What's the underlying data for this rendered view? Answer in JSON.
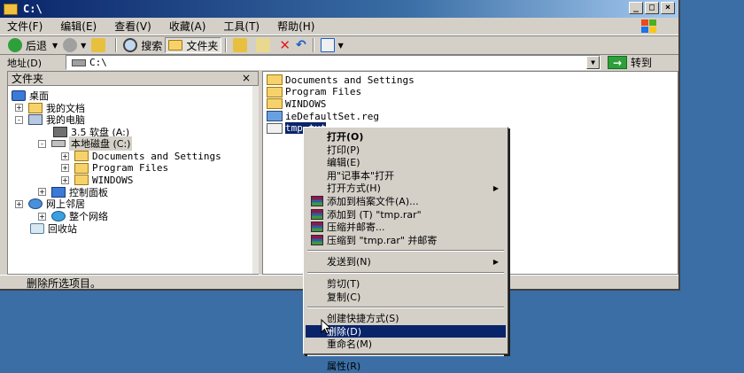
{
  "window": {
    "title": "C:\\",
    "menus": [
      "文件(F)",
      "编辑(E)",
      "查看(V)",
      "收藏(A)",
      "工具(T)",
      "帮助(H)"
    ],
    "toolbar": {
      "back": "后退",
      "search": "搜索",
      "folders": "文件夹"
    },
    "address": {
      "label": "地址(D)",
      "value": "C:\\",
      "go": "转到"
    }
  },
  "left_pane": {
    "header": "文件夹",
    "close": "×",
    "tree": [
      {
        "label": "桌面",
        "level": 0,
        "expander": "",
        "icon": "desktop-icon"
      },
      {
        "label": "我的文档",
        "level": 1,
        "expander": "+",
        "icon": "documents-icon"
      },
      {
        "label": "我的电脑",
        "level": 1,
        "expander": "-",
        "icon": "computer-icon"
      },
      {
        "label": "3.5 软盘 (A:)",
        "level": 2,
        "expander": "",
        "icon": "floppy-icon"
      },
      {
        "label": "本地磁盘 (C:)",
        "level": 2,
        "expander": "-",
        "icon": "disk-icon",
        "selected": true
      },
      {
        "label": "Documents and Settings",
        "level": 3,
        "expander": "+",
        "icon": "folder-icon"
      },
      {
        "label": "Program Files",
        "level": 3,
        "expander": "+",
        "icon": "folder-icon"
      },
      {
        "label": "WINDOWS",
        "level": 3,
        "expander": "+",
        "icon": "folder-icon"
      },
      {
        "label": "控制面板",
        "level": 2,
        "expander": "+",
        "icon": "control-panel-icon"
      },
      {
        "label": "网上邻居",
        "level": 1,
        "expander": "+",
        "icon": "network-icon"
      },
      {
        "label": "整个网络",
        "level": 2,
        "expander": "+",
        "icon": "globe-icon"
      },
      {
        "label": "回收站",
        "level": 1,
        "expander": "",
        "icon": "recycle-bin-icon"
      }
    ]
  },
  "right_pane": {
    "items": [
      {
        "label": "Documents and Settings",
        "icon": "folder-icon"
      },
      {
        "label": "Program Files",
        "icon": "folder-icon"
      },
      {
        "label": "WINDOWS",
        "icon": "folder-icon"
      },
      {
        "label": "ieDefaultSet.reg",
        "icon": "reg-file-icon"
      },
      {
        "label": "tmp.txt",
        "icon": "text-file-icon",
        "selected": true
      }
    ]
  },
  "status": {
    "text": "删除所选项目。"
  },
  "context_menu": {
    "items": [
      {
        "label": "打开(O)",
        "bold": true
      },
      {
        "label": "打印(P)"
      },
      {
        "label": "编辑(E)"
      },
      {
        "label": "用\"记事本\"打开"
      },
      {
        "label": "打开方式(H)",
        "submenu": true
      },
      {
        "label": "添加到档案文件(A)...",
        "icon": "winrar-icon"
      },
      {
        "label": "添加到 (T) \"tmp.rar\"",
        "icon": "winrar-icon"
      },
      {
        "label": "压缩并邮寄...",
        "icon": "winrar-icon"
      },
      {
        "label": "压缩到 \"tmp.rar\" 并邮寄",
        "icon": "winrar-icon"
      },
      {
        "sep": true
      },
      {
        "label": "发送到(N)",
        "submenu": true
      },
      {
        "sep": true
      },
      {
        "label": "剪切(T)"
      },
      {
        "label": "复制(C)"
      },
      {
        "sep": true
      },
      {
        "label": "创建快捷方式(S)"
      },
      {
        "label": "删除(D)",
        "highlighted": true
      },
      {
        "label": "重命名(M)"
      },
      {
        "sep": true
      },
      {
        "label": "属性(R)"
      }
    ]
  },
  "colors": {
    "desktop": "#3a6ea5",
    "title_active": "#0a246a",
    "selection": "#0a246a",
    "face": "#d4d0c8"
  }
}
